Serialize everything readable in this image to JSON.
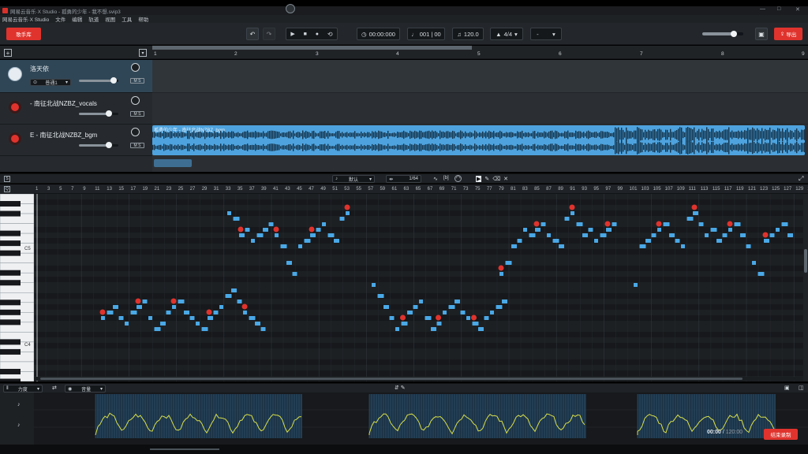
{
  "window": {
    "title": "网易云音乐·X Studio - 孤勇的少年 - 我不想.svip3",
    "controls": [
      "—",
      "□",
      "✕"
    ]
  },
  "menu": [
    "网易云音乐·X Studio",
    "文件",
    "编辑",
    "轨道",
    "视图",
    "工具",
    "帮助"
  ],
  "toolbar": {
    "singer_library": "歌手库",
    "time": "00:00:000",
    "measure": "001 | 00",
    "tempo": "120.0",
    "time_signature": "4/4",
    "key": "-",
    "export": "导出"
  },
  "tracks": [
    {
      "name": "洛天依",
      "mode": "普通1",
      "type": "singer"
    },
    {
      "name": "- 南征北战NZBZ_vocals",
      "type": "audio"
    },
    {
      "name": "E - 南征北战NZBZ_bgm",
      "type": "audio"
    }
  ],
  "ms_label": "M S",
  "clip_label": "孤勇的少年 - 南征北战NZBZ_bgm",
  "arrange_ruler": [
    "1",
    "2",
    "3",
    "4",
    "5",
    "6",
    "7",
    "8",
    "9"
  ],
  "editor": {
    "snap_mode": "默认",
    "quantize": "1/64",
    "tool_label": "[b]",
    "key_labels": [
      "C5",
      "C4"
    ]
  },
  "roll_ruler": [
    "1",
    "3",
    "5",
    "7",
    "9",
    "11",
    "13",
    "15",
    "17",
    "19",
    "21",
    "23",
    "25",
    "27",
    "29",
    "31",
    "33",
    "35",
    "37",
    "39",
    "41",
    "43",
    "45",
    "47",
    "49",
    "51",
    "53",
    "55",
    "57",
    "59",
    "61",
    "63",
    "65",
    "67",
    "69",
    "71",
    "73",
    "75",
    "77",
    "79",
    "81",
    "83",
    "85",
    "87",
    "89",
    "91",
    "93",
    "95",
    "97",
    "99",
    "101",
    "103",
    "105",
    "107",
    "109",
    "111",
    "113",
    "115",
    "117",
    "119",
    "121",
    "123",
    "125",
    "127",
    "129",
    "131"
  ],
  "param": {
    "param_select": "力度",
    "view_select": "音量",
    "lane_labels": [
      "♪",
      "♪"
    ]
  },
  "status": {
    "time": "00:00",
    "total": "120:00",
    "record_button": "结束录制"
  },
  "colors": {
    "accent": "#e0332d",
    "note": "#4aa8e6",
    "clip": "#4ea3de",
    "pitch_line": "#d9e04a"
  }
}
